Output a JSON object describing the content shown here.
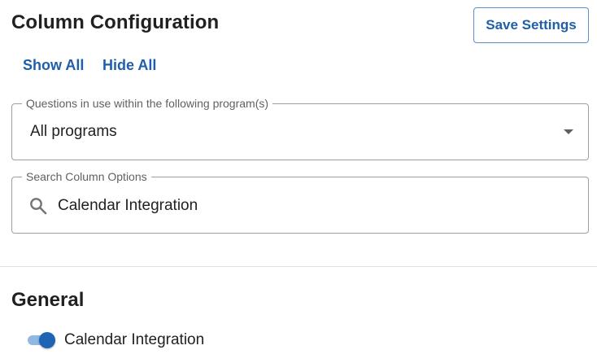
{
  "header": {
    "title": "Column Configuration",
    "save_label": "Save Settings"
  },
  "actions": {
    "show_all": "Show All",
    "hide_all": "Hide All"
  },
  "programs_filter": {
    "legend": "Questions in use within the following program(s)",
    "selected": "All programs"
  },
  "search": {
    "legend": "Search Column Options",
    "value": "Calendar Integration"
  },
  "sections": [
    {
      "title": "General",
      "items": [
        {
          "label": "Calendar Integration",
          "enabled": true
        }
      ]
    }
  ],
  "icons": {
    "search": "search-icon",
    "dropdown": "chevron-down-icon"
  },
  "colors": {
    "accent": "#1f5fa8",
    "toggle_thumb": "#1f63b5",
    "toggle_track": "#90b8e2",
    "border": "#9e9e9e"
  }
}
